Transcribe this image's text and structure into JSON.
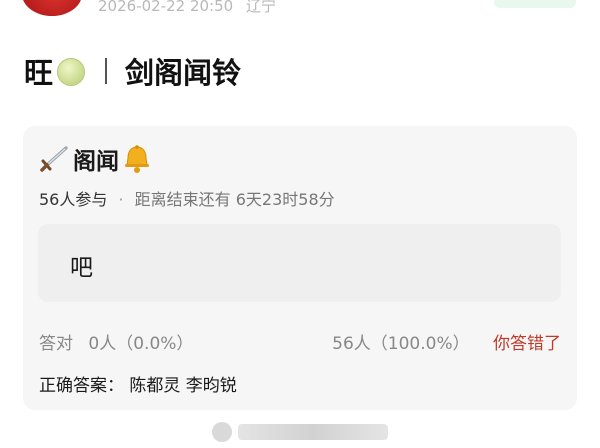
{
  "header": {
    "timestamp": "2026-02-22 20:50",
    "location": "辽宁"
  },
  "post": {
    "title_prefix": "旺",
    "title_emoji": "melon-icon",
    "title_main": "剑阁闻铃"
  },
  "quiz": {
    "title": "阁闻",
    "title_icons": [
      "sword-icon",
      "bell-icon"
    ],
    "participants": "56人参与",
    "countdown": "距离结束还有 6天23时58分",
    "option": "吧",
    "correct_label": "答对",
    "correct_count": "0人（0.0%）",
    "wrong_count": "56人（100.0%）",
    "your_result": "你答错了",
    "answer_label": "正确答案：",
    "answer_value": "陈都灵 李昀锐"
  },
  "colors": {
    "wrong": "#c0392b",
    "card_bg": "#f6f6f6",
    "follow_bg": "#e9f8ec"
  }
}
